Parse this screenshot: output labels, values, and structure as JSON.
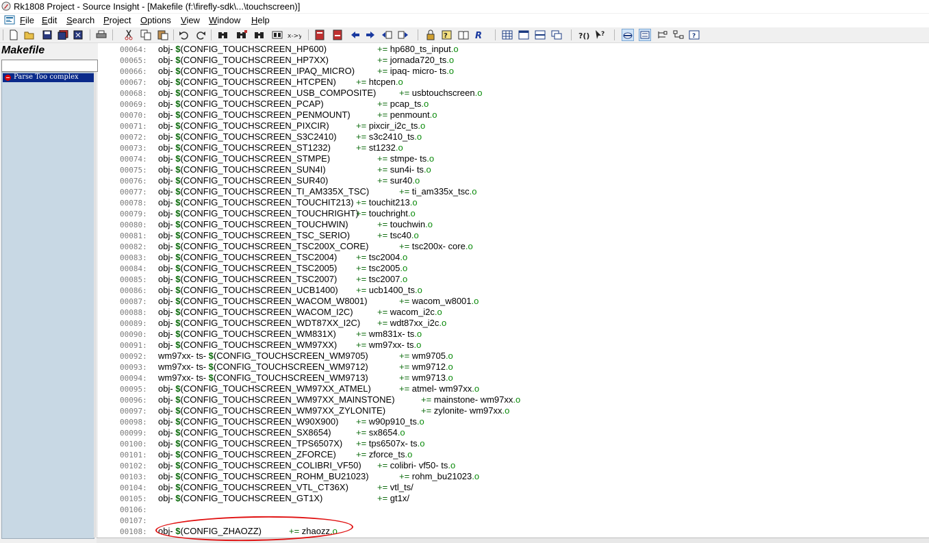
{
  "window": {
    "title": "Rk1808 Project - Source Insight - [Makefile (f:\\firefly-sdk\\...\\touchscreen)]"
  },
  "menu": [
    "File",
    "Edit",
    "Search",
    "Project",
    "Options",
    "View",
    "Window",
    "Help"
  ],
  "menu_mnemonics": [
    "F",
    "E",
    "S",
    "P",
    "O",
    "V",
    "W",
    "H"
  ],
  "left_panel": {
    "title": "Makefile",
    "search_value": "",
    "items": [
      "Parse Too complex"
    ]
  },
  "editor": {
    "lines": [
      {
        "num": "00064:",
        "lhs": "obj-",
        "var": "CONFIG_TOUCHSCREEN_HP600",
        "gap": "",
        "tgt": "hp680_ts_input"
      },
      {
        "num": "00065:",
        "lhs": "obj-",
        "var": "CONFIG_TOUCHSCREEN_HP7XX",
        "gap": "",
        "tgt": "jornada720_ts"
      },
      {
        "num": "00066:",
        "lhs": "obj-",
        "var": "CONFIG_TOUCHSCREEN_IPAQ_MICRO",
        "gap": "",
        "tgt": "ipaq- micro- ts"
      },
      {
        "num": "00067:",
        "lhs": "obj-",
        "var": "CONFIG_TOUCHSCREEN_HTCPEN",
        "gap": "",
        "tgt": "htcpen"
      },
      {
        "num": "00068:",
        "lhs": "obj-",
        "var": "CONFIG_TOUCHSCREEN_USB_COMPOSITE",
        "gap": "",
        "tgt": "usbtouchscreen"
      },
      {
        "num": "00069:",
        "lhs": "obj-",
        "var": "CONFIG_TOUCHSCREEN_PCAP",
        "gap": "",
        "tgt": "pcap_ts"
      },
      {
        "num": "00070:",
        "lhs": "obj-",
        "var": "CONFIG_TOUCHSCREEN_PENMOUNT",
        "gap": "",
        "tgt": "penmount"
      },
      {
        "num": "00071:",
        "lhs": "obj-",
        "var": "CONFIG_TOUCHSCREEN_PIXCIR",
        "gap": "",
        "tgt": "pixcir_i2c_ts"
      },
      {
        "num": "00072:",
        "lhs": "obj-",
        "var": "CONFIG_TOUCHSCREEN_S3C2410",
        "gap": "",
        "tgt": "s3c2410_ts"
      },
      {
        "num": "00073:",
        "lhs": "obj-",
        "var": "CONFIG_TOUCHSCREEN_ST1232",
        "gap": "",
        "tgt": "st1232"
      },
      {
        "num": "00074:",
        "lhs": "obj-",
        "var": "CONFIG_TOUCHSCREEN_STMPE",
        "gap": "",
        "tgt": "stmpe- ts"
      },
      {
        "num": "00075:",
        "lhs": "obj-",
        "var": "CONFIG_TOUCHSCREEN_SUN4I",
        "gap": "",
        "tgt": "sun4i- ts"
      },
      {
        "num": "00076:",
        "lhs": "obj-",
        "var": "CONFIG_TOUCHSCREEN_SUR40",
        "gap": "",
        "tgt": "sur40"
      },
      {
        "num": "00077:",
        "lhs": "obj-",
        "var": "CONFIG_TOUCHSCREEN_TI_AM335X_TSC",
        "gap": "",
        "tgt": "ti_am335x_tsc"
      },
      {
        "num": "00078:",
        "lhs": "obj-",
        "var": "CONFIG_TOUCHSCREEN_TOUCHIT213",
        "gap": "",
        "tgt": "touchit213"
      },
      {
        "num": "00079:",
        "lhs": "obj-",
        "var": "CONFIG_TOUCHSCREEN_TOUCHRIGHT",
        "gap": "",
        "tgt": "touchright"
      },
      {
        "num": "00080:",
        "lhs": "obj-",
        "var": "CONFIG_TOUCHSCREEN_TOUCHWIN",
        "gap": "",
        "tgt": "touchwin"
      },
      {
        "num": "00081:",
        "lhs": "obj-",
        "var": "CONFIG_TOUCHSCREEN_TSC_SERIO",
        "gap": "",
        "tgt": "tsc40"
      },
      {
        "num": "00082:",
        "lhs": "obj-",
        "var": "CONFIG_TOUCHSCREEN_TSC200X_CORE",
        "gap": "",
        "tgt": "tsc200x- core"
      },
      {
        "num": "00083:",
        "lhs": "obj-",
        "var": "CONFIG_TOUCHSCREEN_TSC2004",
        "gap": "",
        "tgt": "tsc2004"
      },
      {
        "num": "00084:",
        "lhs": "obj-",
        "var": "CONFIG_TOUCHSCREEN_TSC2005",
        "gap": "",
        "tgt": "tsc2005"
      },
      {
        "num": "00085:",
        "lhs": "obj-",
        "var": "CONFIG_TOUCHSCREEN_TSC2007",
        "gap": "",
        "tgt": "tsc2007"
      },
      {
        "num": "00086:",
        "lhs": "obj-",
        "var": "CONFIG_TOUCHSCREEN_UCB1400",
        "gap": "",
        "tgt": "ucb1400_ts"
      },
      {
        "num": "00087:",
        "lhs": "obj-",
        "var": "CONFIG_TOUCHSCREEN_WACOM_W8001",
        "gap": "",
        "tgt": "wacom_w8001"
      },
      {
        "num": "00088:",
        "lhs": "obj-",
        "var": "CONFIG_TOUCHSCREEN_WACOM_I2C",
        "gap": "",
        "tgt": "wacom_i2c"
      },
      {
        "num": "00089:",
        "lhs": "obj-",
        "var": "CONFIG_TOUCHSCREEN_WDT87XX_I2C",
        "gap": "",
        "tgt": "wdt87xx_i2c"
      },
      {
        "num": "00090:",
        "lhs": "obj-",
        "var": "CONFIG_TOUCHSCREEN_WM831X",
        "gap": "",
        "tgt": "wm831x- ts"
      },
      {
        "num": "00091:",
        "lhs": "obj-",
        "var": "CONFIG_TOUCHSCREEN_WM97XX",
        "gap": "",
        "tgt": "wm97xx- ts"
      },
      {
        "num": "00092:",
        "lhs": "wm97xx- ts-",
        "var": "CONFIG_TOUCHSCREEN_WM9705",
        "gap": "",
        "tgt": "wm9705"
      },
      {
        "num": "00093:",
        "lhs": "wm97xx- ts-",
        "var": "CONFIG_TOUCHSCREEN_WM9712",
        "gap": "",
        "tgt": "wm9712"
      },
      {
        "num": "00094:",
        "lhs": "wm97xx- ts-",
        "var": "CONFIG_TOUCHSCREEN_WM9713",
        "gap": "",
        "tgt": "wm9713"
      },
      {
        "num": "00095:",
        "lhs": "obj-",
        "var": "CONFIG_TOUCHSCREEN_WM97XX_ATMEL",
        "gap": "",
        "tgt": "atmel- wm97xx"
      },
      {
        "num": "00096:",
        "lhs": "obj-",
        "var": "CONFIG_TOUCHSCREEN_WM97XX_MAINSTONE",
        "gap": "",
        "tgt": "mainstone- wm97xx"
      },
      {
        "num": "00097:",
        "lhs": "obj-",
        "var": "CONFIG_TOUCHSCREEN_WM97XX_ZYLONITE",
        "gap": "",
        "tgt": "zylonite- wm97xx"
      },
      {
        "num": "00098:",
        "lhs": "obj-",
        "var": "CONFIG_TOUCHSCREEN_W90X900",
        "gap": "",
        "tgt": "w90p910_ts"
      },
      {
        "num": "00099:",
        "lhs": "obj-",
        "var": "CONFIG_TOUCHSCREEN_SX8654",
        "gap": "",
        "tgt": "sx8654"
      },
      {
        "num": "00100:",
        "lhs": "obj-",
        "var": "CONFIG_TOUCHSCREEN_TPS6507X",
        "gap": "",
        "tgt": "tps6507x- ts"
      },
      {
        "num": "00101:",
        "lhs": "obj-",
        "var": "CONFIG_TOUCHSCREEN_ZFORCE",
        "gap": "",
        "tgt": "zforce_ts"
      },
      {
        "num": "00102:",
        "lhs": "obj-",
        "var": "CONFIG_TOUCHSCREEN_COLIBRI_VF50",
        "gap": "",
        "tgt": "colibri- vf50- ts"
      },
      {
        "num": "00103:",
        "lhs": "obj-",
        "var": "CONFIG_TOUCHSCREEN_ROHM_BU21023",
        "gap": "",
        "tgt": "rohm_bu21023"
      },
      {
        "num": "00104:",
        "lhs": "obj-",
        "var": "CONFIG_TOUCHSCREEN_VTL_CT36X",
        "gap": "",
        "tgt": "vtl_ts/",
        "dir": true
      },
      {
        "num": "00105:",
        "lhs": "obj-",
        "var": "CONFIG_TOUCHSCREEN_GT1X",
        "gap": "",
        "tgt": "gt1x/",
        "dir": true
      },
      {
        "num": "00106:",
        "empty": true
      },
      {
        "num": "00107:",
        "empty": true
      },
      {
        "num": "00108:",
        "lhs": "obj-",
        "var": "CONFIG_ZHAOZZ",
        "gap": "",
        "tgt": "zhaozz",
        "highlighted": true
      }
    ],
    "assign_op": "+=",
    "obj_ext": ".o",
    "dollar": "$"
  },
  "colors": {
    "green": "#0a6a0a",
    "annotation_red": "#e01010"
  }
}
